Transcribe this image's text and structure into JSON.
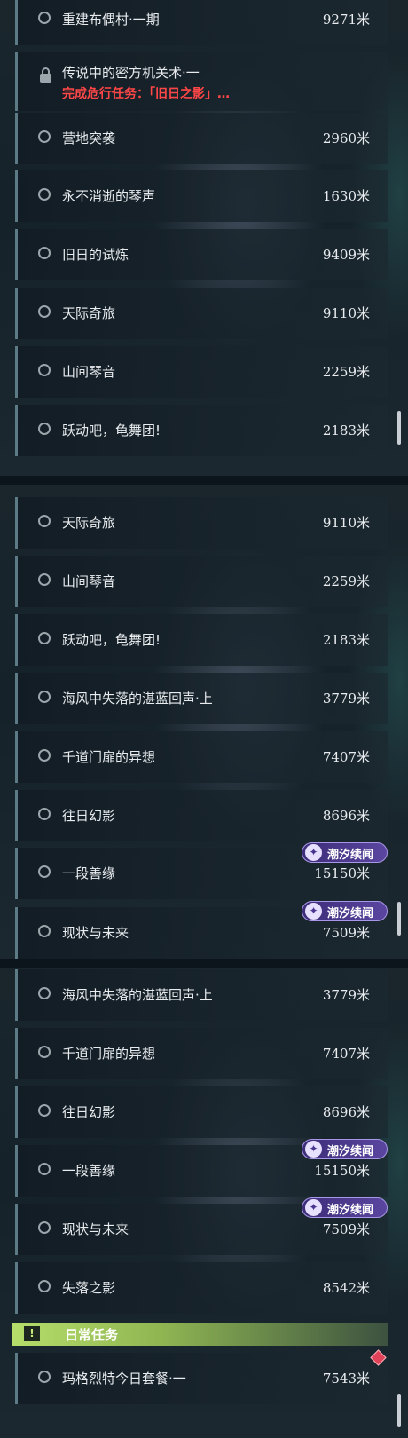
{
  "frame1": {
    "rows": [
      {
        "name": "重建布偶村·一期",
        "dist": "9271米"
      },
      {
        "name": "传说中的密方机关术·一",
        "sub": "完成危行任务：「旧日之影」…"
      },
      {
        "name": "营地突袭",
        "dist": "2960米"
      },
      {
        "name": "永不消逝的琴声",
        "dist": "1630米"
      },
      {
        "name": "旧日的试炼",
        "dist": "9409米"
      },
      {
        "name": "天际奇旅",
        "dist": "9110米"
      },
      {
        "name": "山间琴音",
        "dist": "2259米"
      },
      {
        "name": "跃动吧，龟舞团!",
        "dist": "2183米"
      }
    ]
  },
  "frame2": {
    "rows": [
      {
        "name": "天际奇旅",
        "dist": "9110米"
      },
      {
        "name": "山间琴音",
        "dist": "2259米"
      },
      {
        "name": "跃动吧，龟舞团!",
        "dist": "2183米"
      },
      {
        "name": "海风中失落的湛蓝回声·上",
        "dist": "3779米"
      },
      {
        "name": "千道门扉的异想",
        "dist": "7407米"
      },
      {
        "name": "往日幻影",
        "dist": "8696米"
      },
      {
        "name": "一段善缘",
        "dist": "15150米"
      },
      {
        "name": "现状与未来",
        "dist": "7509米"
      }
    ]
  },
  "frame3": {
    "rows": [
      {
        "name": "海风中失落的湛蓝回声·上",
        "dist": "3779米"
      },
      {
        "name": "千道门扉的异想",
        "dist": "7407米"
      },
      {
        "name": "往日幻影",
        "dist": "8696米"
      },
      {
        "name": "一段善缘",
        "dist": "15150米"
      },
      {
        "name": "现状与未来",
        "dist": "7509米"
      },
      {
        "name": "失落之影",
        "dist": "8542米"
      }
    ],
    "daily": {
      "header": "日常任务",
      "icon": "!",
      "row": {
        "name": "玛格烈特今日套餐·一",
        "dist": "7543米"
      }
    }
  },
  "tag_label": "潮汐续闻",
  "tag_icon": "✦",
  "colors": {
    "accent_red": "#ff4747",
    "tag_purple": "#5a46a0",
    "daily_green": "#b6de6a"
  }
}
